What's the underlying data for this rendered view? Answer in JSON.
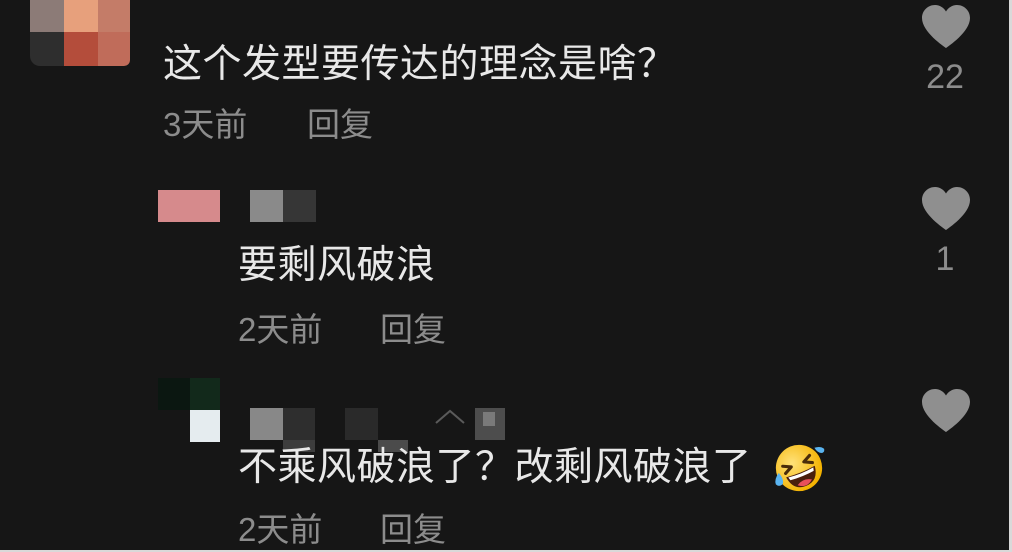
{
  "theme": {
    "background": "#161616",
    "text": "#e8e8e8",
    "muted": "#8c8c8c",
    "like_icon": "#8f8f8f"
  },
  "comment": {
    "text": "这个发型要传达的理念是啥？",
    "time": "3天前",
    "reply_label": "回复",
    "like_icon": "heart-icon",
    "likes": 22,
    "replies": [
      {
        "text": "要剩风破浪",
        "time": "2天前",
        "reply_label": "回复",
        "like_icon": "heart-icon",
        "likes": 1
      },
      {
        "text": "不乘风破浪了？改剩风破浪了",
        "emoji": "rolling-on-the-floor-laughing-icon",
        "time": "2天前",
        "reply_label": "回复",
        "like_icon": "heart-icon"
      }
    ]
  }
}
